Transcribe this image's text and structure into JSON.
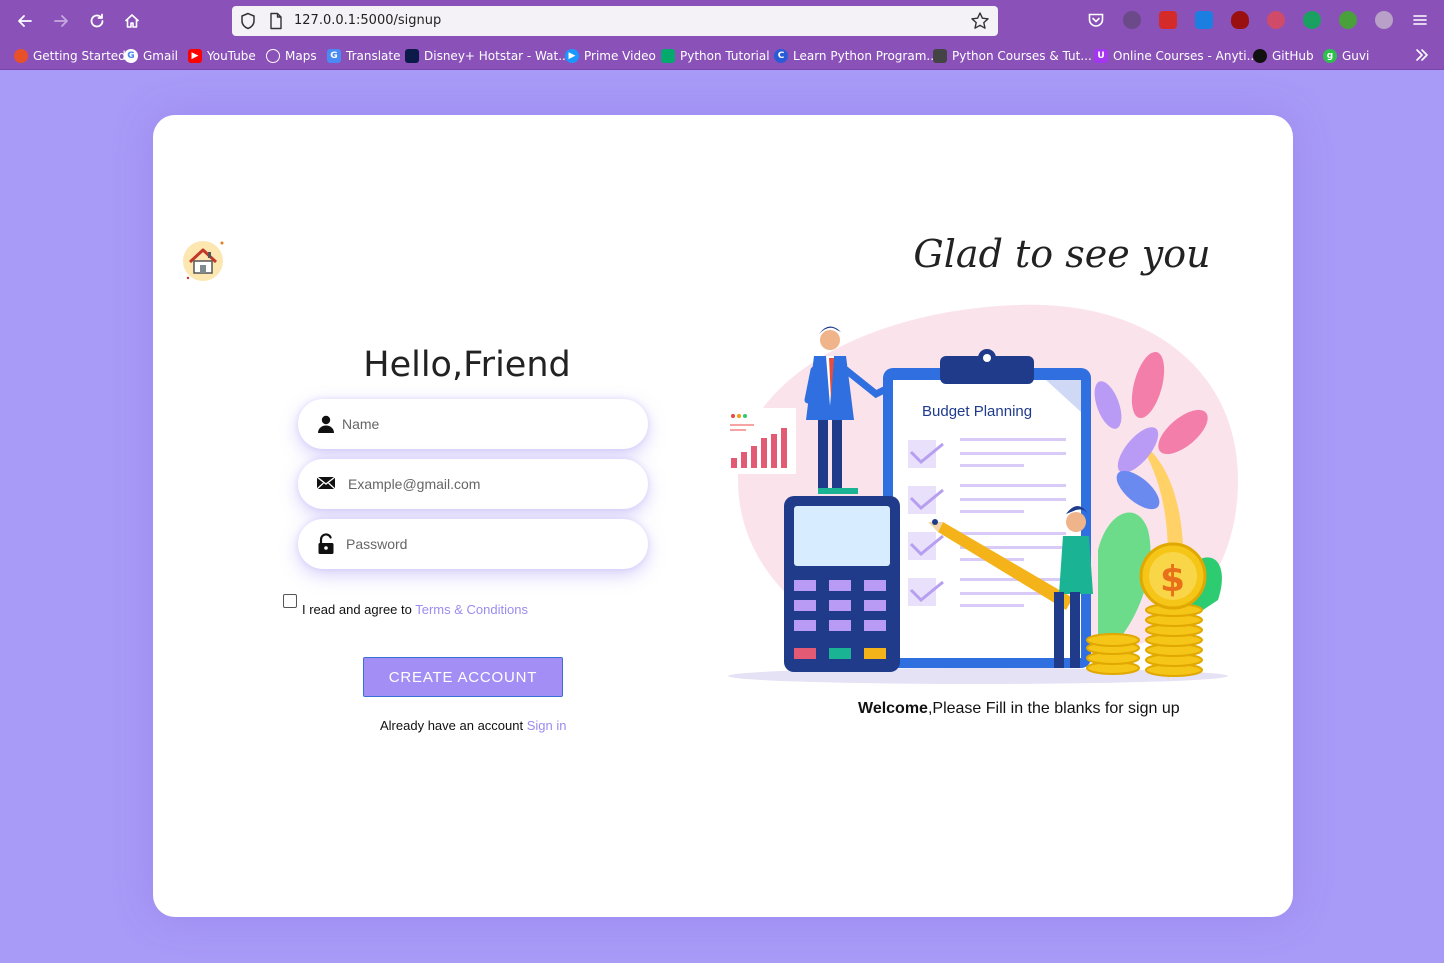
{
  "browser": {
    "url": "127.0.0.1:5000/signup",
    "bookmarks": [
      {
        "label": "Getting Started",
        "color": "#e8502a"
      },
      {
        "label": "Gmail",
        "color": "#ffffff"
      },
      {
        "label": "YouTube",
        "color": "#ff0000"
      },
      {
        "label": "Maps",
        "color": "#ffffff"
      },
      {
        "label": "Translate",
        "color": "#4a8af4"
      },
      {
        "label": "Disney+ Hotstar - Wat...",
        "color": "#0c1a4a"
      },
      {
        "label": "Prime Video",
        "color": "#1a98ff"
      },
      {
        "label": "Python Tutorial",
        "color": "#04aa6d"
      },
      {
        "label": "Learn Python Program...",
        "color": "#2a5bd7"
      },
      {
        "label": "Python Courses & Tut...",
        "color": "#444444"
      },
      {
        "label": "Online Courses - Anyti...",
        "color": "#a435f0"
      },
      {
        "label": "GitHub",
        "color": "#111111"
      },
      {
        "label": "Guvi",
        "color": "#2fbf4f"
      }
    ]
  },
  "form": {
    "heading": "Hello,Friend",
    "name_placeholder": "Name",
    "email_placeholder": "Example@gmail.com",
    "password_placeholder": "Password",
    "terms_prefix": "I read and agree to ",
    "terms_link": "Terms & Conditions",
    "create_label": "CREATE ACCOUNT",
    "signin_prefix": "Already have an account ",
    "signin_link": "Sign in"
  },
  "hero": {
    "title": "Glad to see you",
    "illustration_label": "Budget  Planning",
    "welcome_bold": "Welcome",
    "welcome_rest": ",Please Fill in the blanks for sign up"
  },
  "colors": {
    "page_bg": "#a89af7",
    "accent": "#a38ef5",
    "link": "#9a8cf0",
    "chrome": "#8a52b8"
  }
}
